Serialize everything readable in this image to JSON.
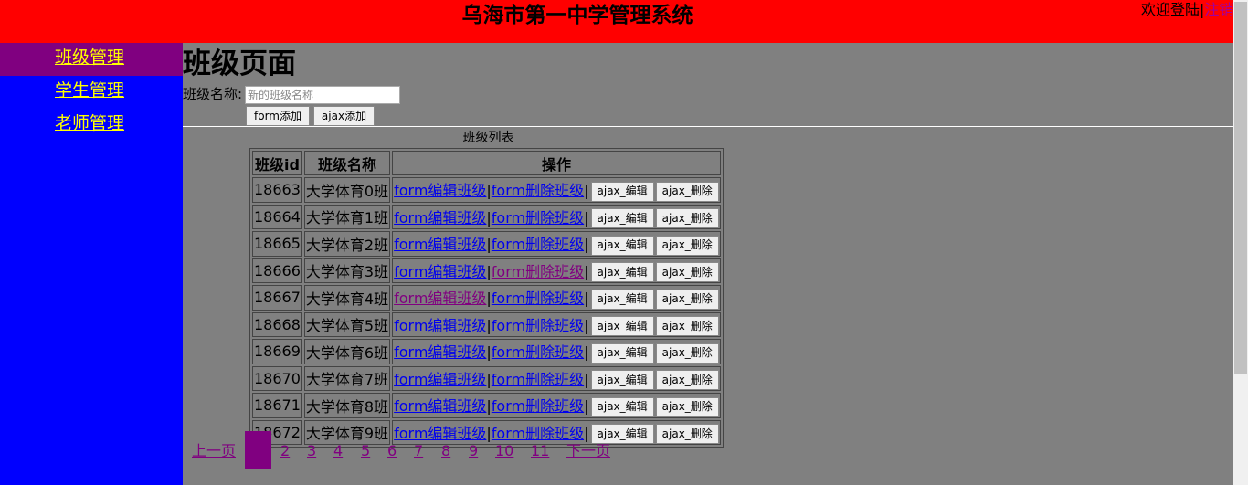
{
  "header": {
    "title": "乌海市第一中学管理系统",
    "welcome_text": "欢迎登陆",
    "separator": "|",
    "logout_label": "注销"
  },
  "sidebar": {
    "items": [
      {
        "label": "班级管理",
        "active": true
      },
      {
        "label": "学生管理",
        "active": false
      },
      {
        "label": "老师管理",
        "active": false
      }
    ]
  },
  "main": {
    "heading": "班级页面",
    "form": {
      "label": "班级名称:",
      "input_placeholder": "新的班级名称",
      "input_value": "",
      "form_add_label": "form添加",
      "ajax_add_label": "ajax添加"
    },
    "table": {
      "caption": "班级列表",
      "headers": [
        "班级id",
        "班级名称",
        "操作"
      ],
      "edit_link_label": "form编辑班级",
      "delete_link_label": "form删除班级",
      "link_separator": "|",
      "ajax_edit_label": "ajax_编辑",
      "ajax_delete_label": "ajax_删除",
      "rows": [
        {
          "id": "18663",
          "name": "大学体育0班"
        },
        {
          "id": "18664",
          "name": "大学体育1班"
        },
        {
          "id": "18665",
          "name": "大学体育2班"
        },
        {
          "id": "18666",
          "name": "大学体育3班"
        },
        {
          "id": "18667",
          "name": "大学体育4班"
        },
        {
          "id": "18668",
          "name": "大学体育5班"
        },
        {
          "id": "18669",
          "name": "大学体育6班"
        },
        {
          "id": "18670",
          "name": "大学体育7班"
        },
        {
          "id": "18671",
          "name": "大学体育8班"
        },
        {
          "id": "18672",
          "name": "大学体育9班"
        }
      ]
    },
    "pagination": {
      "prev_label": "上一页",
      "current_page": "1",
      "pages": [
        "2",
        "3",
        "4",
        "5",
        "6",
        "7",
        "8",
        "9",
        "10",
        "11"
      ],
      "next_label": "下一页"
    }
  },
  "colors": {
    "header_bg": "#ff0000",
    "sidebar_bg": "#0000ff",
    "active_nav_bg": "#800080",
    "nav_link": "#ffff00",
    "page_bg": "#808080",
    "link": "#0000ee",
    "visited_link": "#800080"
  }
}
